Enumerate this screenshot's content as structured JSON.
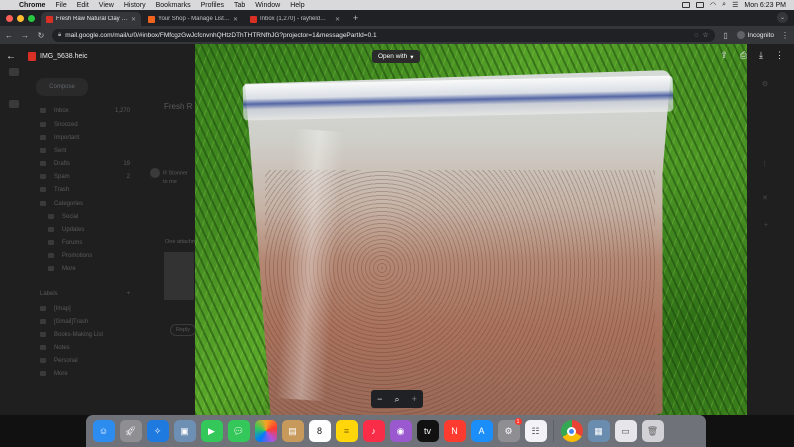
{
  "menubar": {
    "app_name": "Chrome",
    "menus": [
      "File",
      "Edit",
      "View",
      "History",
      "Bookmarks",
      "Profiles",
      "Tab",
      "Window",
      "Help"
    ],
    "clock": "Mon 6:23 PM"
  },
  "tabs": [
    {
      "title": "Fresh Raw Natural Clay Fresh",
      "active": true,
      "favicon_color": "#d93025"
    },
    {
      "title": "Your Shop - Manage Listings",
      "active": false,
      "favicon_color": "#f1641e"
    },
    {
      "title": "Inbox (1,270) - rayfield@tho",
      "active": false,
      "favicon_color": "#d93025"
    }
  ],
  "toolbar": {
    "url": "mail.google.com/mail/u/0/#inbox/FMfcgzGwJcfcnvnhQHtzDThTHTRNfhJG?projector=1&messagePartId=0.1",
    "profile_label": "Incognito"
  },
  "viewer": {
    "file_name": "IMG_5638.heic",
    "open_with_label": "Open with"
  },
  "gmail_bg": {
    "compose_label": "Compose",
    "folders": [
      {
        "label": "Inbox",
        "count": "1,270"
      },
      {
        "label": "Snoozed",
        "count": ""
      },
      {
        "label": "Important",
        "count": ""
      },
      {
        "label": "Sent",
        "count": ""
      },
      {
        "label": "Drafts",
        "count": "19"
      },
      {
        "label": "Spam",
        "count": "2"
      },
      {
        "label": "Trash",
        "count": ""
      },
      {
        "label": "Categories",
        "count": ""
      },
      {
        "label": "Social",
        "count": ""
      },
      {
        "label": "Updates",
        "count": ""
      },
      {
        "label": "Forums",
        "count": ""
      },
      {
        "label": "Promotions",
        "count": ""
      },
      {
        "label": "More",
        "count": ""
      }
    ],
    "labels_header": "Labels",
    "labels": [
      "[Imap]",
      "[Gmail]Trash",
      "Books-Making List",
      "Notes",
      "Personal",
      "More"
    ],
    "subject": "Fresh R",
    "sender_line1": "R Stonner",
    "sender_line2": "to me",
    "one_attachment": "One attachment",
    "reply_label": "Reply"
  },
  "dock": [
    {
      "name": "finder",
      "color": "#2d8cf0"
    },
    {
      "name": "launchpad",
      "color": "#8e8e93"
    },
    {
      "name": "safari",
      "color": "#1f7ae0"
    },
    {
      "name": "preview",
      "color": "#6d8fb3"
    },
    {
      "name": "facetime",
      "color": "#34c759"
    },
    {
      "name": "messages",
      "color": "#34c759"
    },
    {
      "name": "photos",
      "color": "#f5a623"
    },
    {
      "name": "notefile",
      "color": "#c79a5b"
    },
    {
      "name": "calendar",
      "color": "#ffffff",
      "text": "8"
    },
    {
      "name": "notes",
      "color": "#ffd60a"
    },
    {
      "name": "music",
      "color": "#fa2d48"
    },
    {
      "name": "podcasts",
      "color": "#9b59d0"
    },
    {
      "name": "apple-tv",
      "color": "#111111",
      "text": "tv"
    },
    {
      "name": "news",
      "color": "#ff3b30"
    },
    {
      "name": "app-store",
      "color": "#1c8ef9"
    },
    {
      "name": "system-preferences",
      "color": "#8e8e93",
      "badge": "1"
    },
    {
      "name": "reminders",
      "color": "#f2f2f7"
    },
    {
      "name": "chrome",
      "color": "#ffffff"
    },
    {
      "name": "photo-viewer",
      "color": "#6a8caf"
    },
    {
      "name": "documents",
      "color": "#e5e5ea"
    },
    {
      "name": "trash",
      "color": "#d1d1d6"
    }
  ]
}
